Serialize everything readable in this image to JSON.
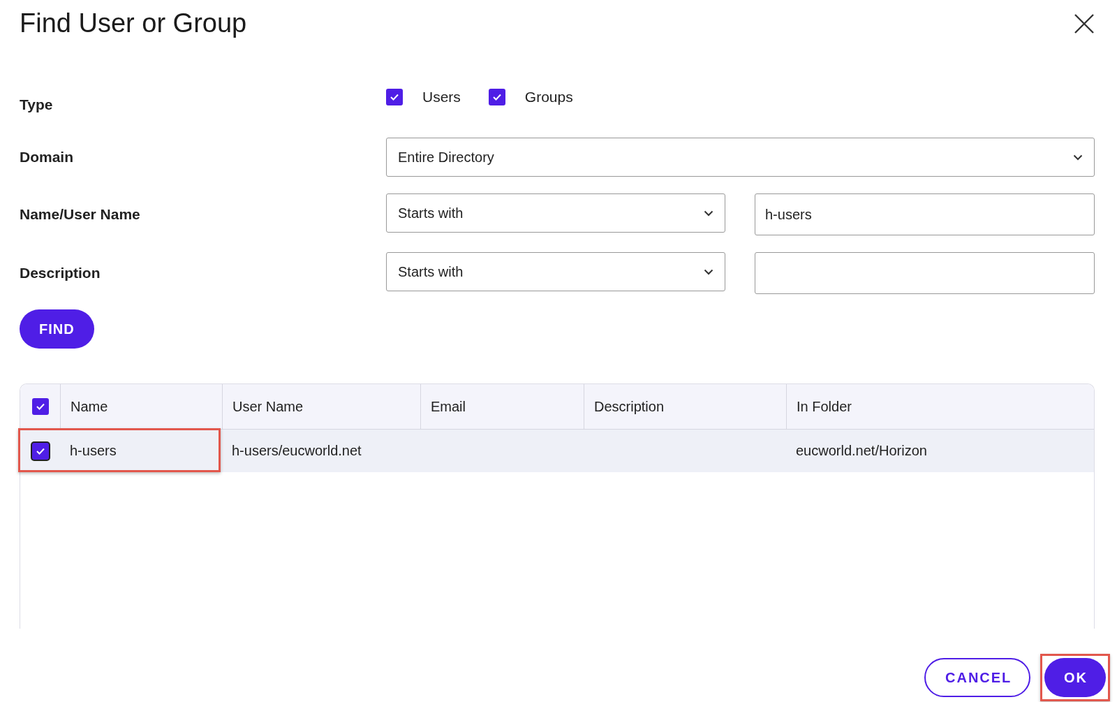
{
  "dialog": {
    "title": "Find User or Group"
  },
  "form": {
    "type": {
      "label": "Type",
      "options": [
        {
          "label": "Users",
          "checked": true
        },
        {
          "label": "Groups",
          "checked": true
        }
      ]
    },
    "domain": {
      "label": "Domain",
      "value": "Entire Directory"
    },
    "name": {
      "label": "Name/User Name",
      "operator": "Starts with",
      "value": "h-users"
    },
    "description": {
      "label": "Description",
      "operator": "Starts with"
    }
  },
  "find_button": "FIND",
  "table": {
    "select_all": true,
    "columns": [
      "Name",
      "User Name",
      "Email",
      "Description",
      "In Folder"
    ],
    "rows": [
      {
        "selected": true,
        "highlighted": true,
        "name": "h-users",
        "user_name": "h-users/eucworld.net",
        "in_folder": "eucworld.net/Horizon"
      }
    ]
  },
  "buttons": [
    {
      "label": "CANCEL",
      "kind": "secondary",
      "highlighted": false
    },
    {
      "label": "OK",
      "kind": "primary",
      "highlighted": true
    }
  ]
}
